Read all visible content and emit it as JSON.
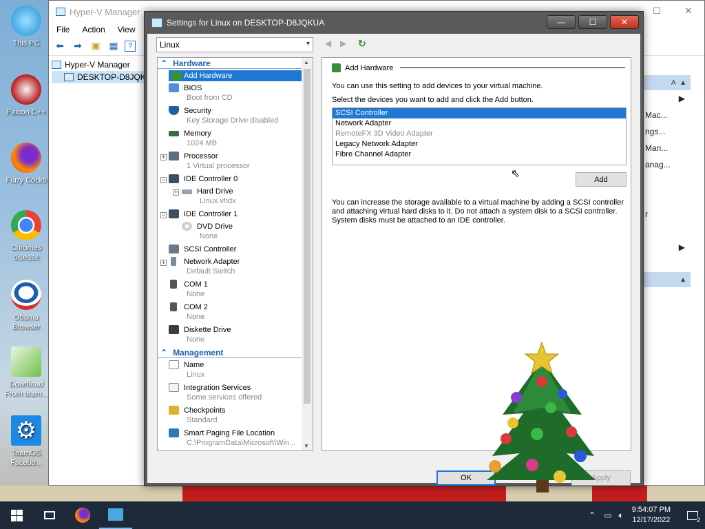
{
  "desktop": {
    "icons": [
      {
        "label": "This PC"
      },
      {
        "label": "Falcon C++"
      },
      {
        "label": "Furry Cocks"
      },
      {
        "label": "Chromes disease"
      },
      {
        "label": "Obama Browser"
      },
      {
        "label": "Download From team..."
      },
      {
        "label": "TeamOS Facebo..."
      }
    ]
  },
  "hyperv": {
    "title": "Hyper-V Manager",
    "menu": [
      "File",
      "Action",
      "View"
    ],
    "tree": {
      "root": "Hyper-V Manager",
      "host": "DESKTOP-D8JQKUA"
    },
    "right_items": [
      "A",
      "Mac...",
      "ngs...",
      "Man...",
      "anag...",
      "r"
    ]
  },
  "dialog": {
    "title": "Settings for Linux on DESKTOP-D8JQKUA",
    "vm_select": "Linux",
    "hardware_header": "Hardware",
    "management_header": "Management",
    "hardware_items": [
      {
        "label": "Add Hardware",
        "sub": ""
      },
      {
        "label": "BIOS",
        "sub": "Boot from CD"
      },
      {
        "label": "Security",
        "sub": "Key Storage Drive disabled"
      },
      {
        "label": "Memory",
        "sub": "1024 MB"
      },
      {
        "label": "Processor",
        "sub": "1 Virtual processor"
      },
      {
        "label": "IDE Controller 0",
        "sub": ""
      },
      {
        "label": "Hard Drive",
        "sub": "Linux.vhdx"
      },
      {
        "label": "IDE Controller 1",
        "sub": ""
      },
      {
        "label": "DVD Drive",
        "sub": "None"
      },
      {
        "label": "SCSI Controller",
        "sub": ""
      },
      {
        "label": "Network Adapter",
        "sub": "Default Switch"
      },
      {
        "label": "COM 1",
        "sub": "None"
      },
      {
        "label": "COM 2",
        "sub": "None"
      },
      {
        "label": "Diskette Drive",
        "sub": "None"
      }
    ],
    "management_items": [
      {
        "label": "Name",
        "sub": "Linux"
      },
      {
        "label": "Integration Services",
        "sub": "Some services offered"
      },
      {
        "label": "Checkpoints",
        "sub": "Standard"
      },
      {
        "label": "Smart Paging File Location",
        "sub": "C:\\ProgramData\\Microsoft\\Win..."
      }
    ],
    "panel": {
      "title": "Add Hardware",
      "intro": "You can use this setting to add devices to your virtual machine.",
      "instruction": "Select the devices you want to add and click the Add button.",
      "devices": [
        {
          "label": "SCSI Controller",
          "state": "selected"
        },
        {
          "label": "Network Adapter",
          "state": "normal"
        },
        {
          "label": "RemoteFX 3D Video Adapter",
          "state": "disabled"
        },
        {
          "label": "Legacy Network Adapter",
          "state": "normal"
        },
        {
          "label": "Fibre Channel Adapter",
          "state": "normal"
        }
      ],
      "add_label": "Add",
      "description": "You can increase the storage available to a virtual machine by adding a SCSI controller and attaching virtual hard disks to it. Do not attach a system disk to a SCSI controller. System disks must be attached to an IDE controller."
    },
    "ok_label": "OK",
    "apply_label": "Apply"
  },
  "taskbar": {
    "time": "9:54:07 PM",
    "date": "12/17/2022",
    "notifications": "2"
  }
}
